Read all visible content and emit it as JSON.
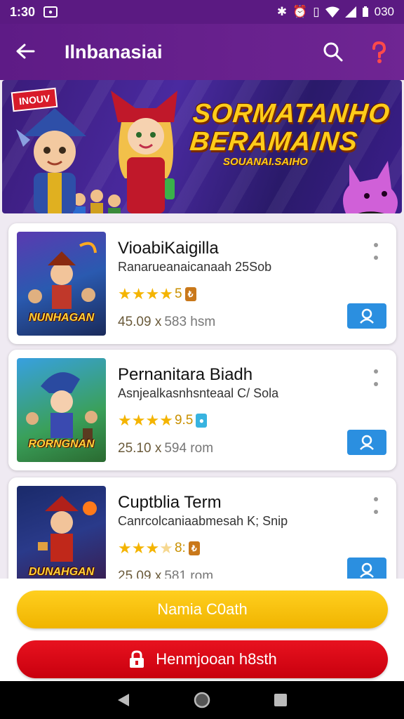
{
  "status_bar": {
    "time": "1:30",
    "battery": "030",
    "icons": [
      "notification-icon",
      "bluetooth-icon",
      "alarm-icon",
      "vibrate-icon",
      "wifi-icon",
      "signal-icon",
      "battery-icon"
    ]
  },
  "app_bar": {
    "title": "Ilnbanasiai",
    "icons": [
      "back-arrow-icon",
      "search-icon",
      "help-icon"
    ]
  },
  "banner": {
    "badge": "INOUV",
    "headline_1": "SORMATANHO",
    "headline_2": "BERAMAINS",
    "subheadline": "SOUANAI.SAIHO"
  },
  "games": [
    {
      "name": "VioabiKaigilla",
      "subtitle": "Ranarueanaicanaah 25Sob",
      "rating_text": "5",
      "price": "45.09 x",
      "meta": "583 hsm",
      "thumb_title": "NUNHAGAN",
      "accent": "#c9781a"
    },
    {
      "name": "Pernanitara Biadh",
      "subtitle": "Asnjealkasnhsnteaal C/ Sola",
      "rating_text": "9.5",
      "price": "25.10 x",
      "meta": "594 rom",
      "thumb_title": "RORNGNAN",
      "accent": "#38b3e0"
    },
    {
      "name": "Cuptblia Term",
      "subtitle": "Canrcolcaniaabmesah K; Snip",
      "rating_text": "8:",
      "price": "25.09 x",
      "meta": "581 rom",
      "thumb_title": "DUNAHGAN",
      "accent": "#c9781a"
    }
  ],
  "buttons": {
    "primary": "Namia C0ath",
    "secondary": "Henmjooan h8sth"
  },
  "colors": {
    "app_bar": "#5e1b86",
    "primary_button": "#f5bf10",
    "secondary_button": "#d8101c",
    "action_button": "#2b8fe0"
  }
}
